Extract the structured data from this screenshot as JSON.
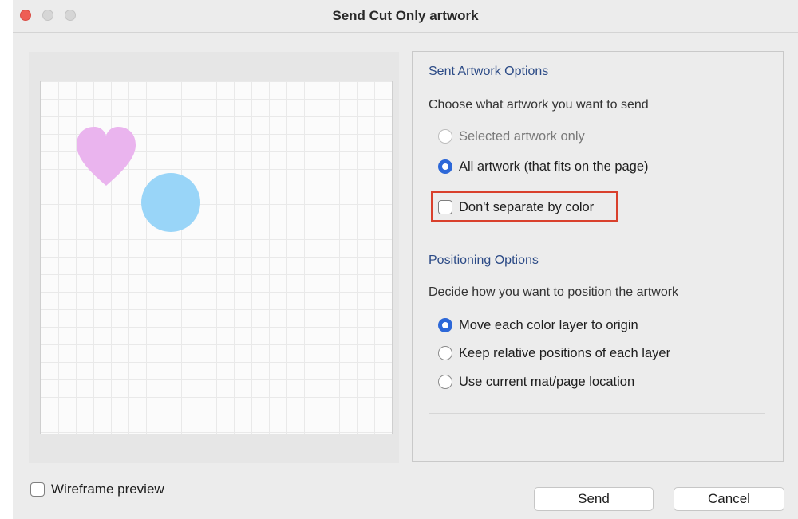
{
  "window": {
    "title": "Send Cut Only artwork"
  },
  "sent_artwork": {
    "title": "Sent Artwork Options",
    "description": "Choose what artwork you want to send",
    "options": [
      {
        "label": "Selected artwork only",
        "selected": false,
        "disabled": true
      },
      {
        "label": "All artwork (that fits on the page)",
        "selected": true,
        "disabled": false
      }
    ],
    "separate_checkbox": {
      "label": "Don't separate by color",
      "checked": false
    }
  },
  "positioning": {
    "title": "Positioning Options",
    "description": "Decide how you want to position the artwork",
    "options": [
      {
        "label": "Move each color layer to origin",
        "selected": true
      },
      {
        "label": "Keep relative positions of each layer",
        "selected": false
      },
      {
        "label": "Use current mat/page location",
        "selected": false
      }
    ]
  },
  "wireframe": {
    "label": "Wireframe preview",
    "checked": false
  },
  "buttons": {
    "send": "Send",
    "cancel": "Cancel"
  },
  "colors": {
    "accent": "#2d68d8",
    "section_title": "#2b4a86",
    "highlight": "#d9402c",
    "heart": "#eab4ee",
    "circle": "#99d5f8"
  }
}
